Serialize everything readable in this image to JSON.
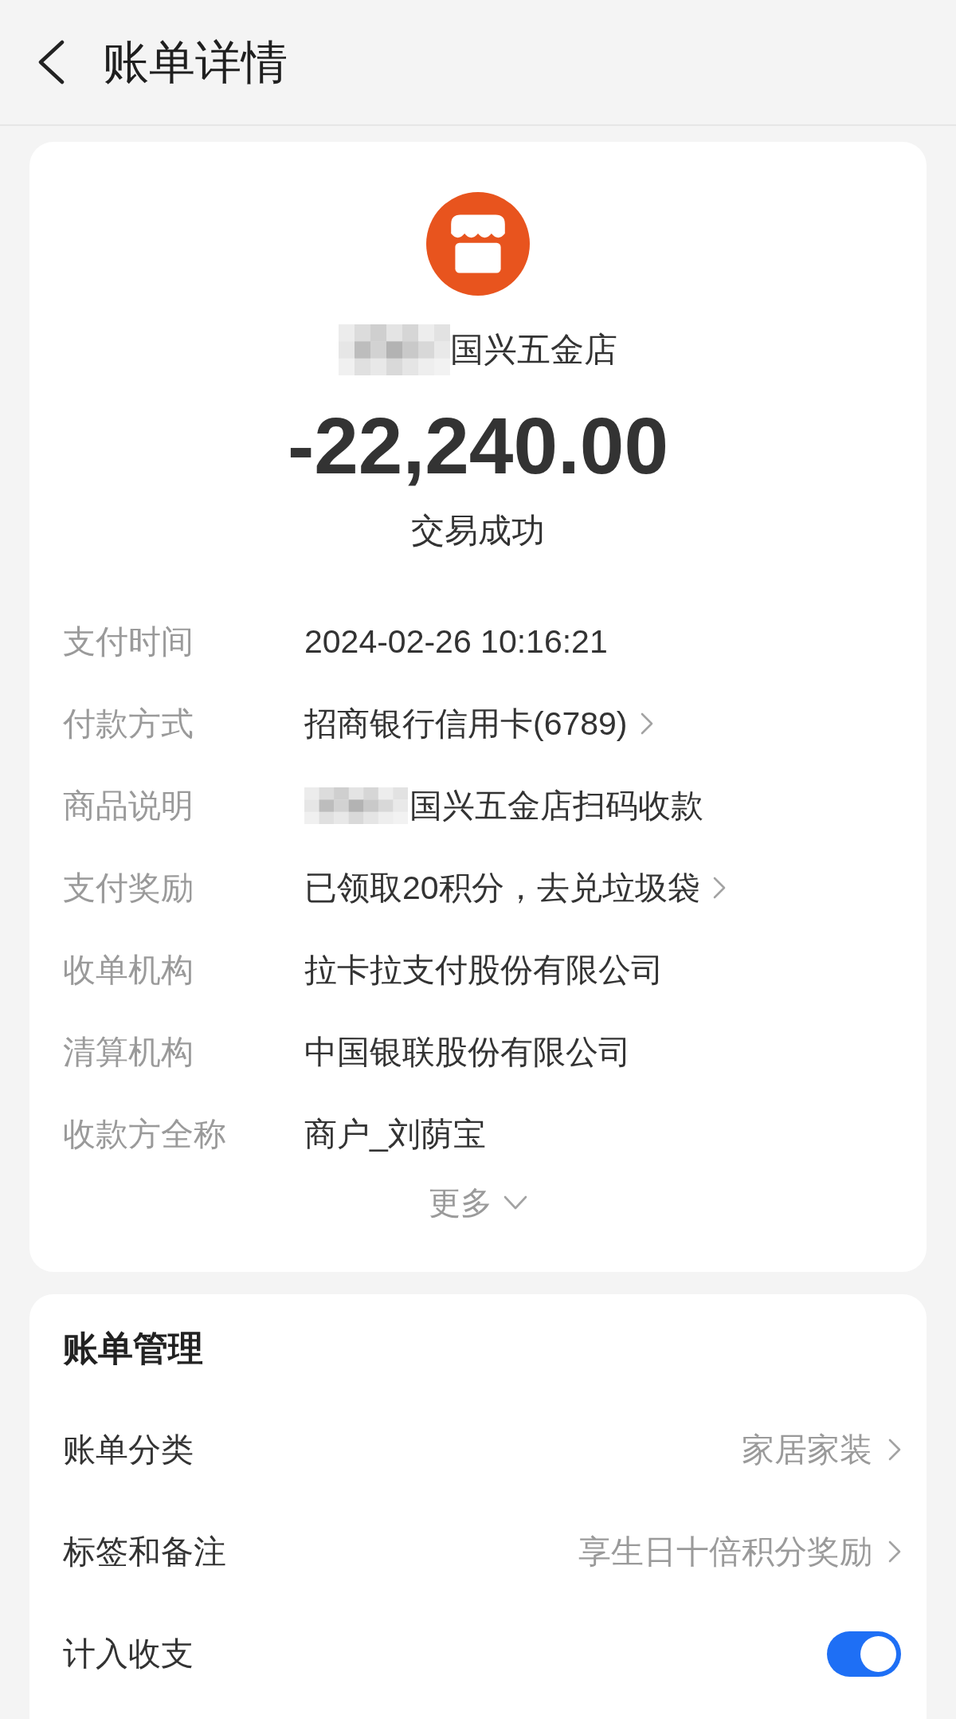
{
  "header": {
    "title": "账单详情"
  },
  "summary": {
    "redacted": true,
    "merchant": "国兴五金店",
    "amount": "-22,240.00",
    "status": "交易成功"
  },
  "details": [
    {
      "label": "支付时间",
      "value": "2024-02-26 10:16:21",
      "redacted": false,
      "link": false
    },
    {
      "label": "付款方式",
      "value": "招商银行信用卡(6789)",
      "redacted": false,
      "link": true
    },
    {
      "label": "商品说明",
      "value": "国兴五金店扫码收款",
      "redacted": true,
      "link": false
    },
    {
      "label": "支付奖励",
      "value": "已领取20积分，去兑垃圾袋",
      "redacted": false,
      "link": true
    },
    {
      "label": "收单机构",
      "value": "拉卡拉支付股份有限公司",
      "redacted": false,
      "link": false
    },
    {
      "label": "清算机构",
      "value": "中国银联股份有限公司",
      "redacted": false,
      "link": false
    },
    {
      "label": "收款方全称",
      "value": "商户_刘荫宝",
      "redacted": false,
      "link": false
    }
  ],
  "more": {
    "label": "更多",
    "expanded": false
  },
  "management": {
    "title": "账单管理",
    "rows": [
      {
        "kind": "link",
        "label": "账单分类",
        "value": "家居家装"
      },
      {
        "kind": "link",
        "label": "标签和备注",
        "value": "享生日十倍积分奖励"
      },
      {
        "kind": "toggle",
        "label": "计入收支",
        "on": true
      }
    ]
  }
}
